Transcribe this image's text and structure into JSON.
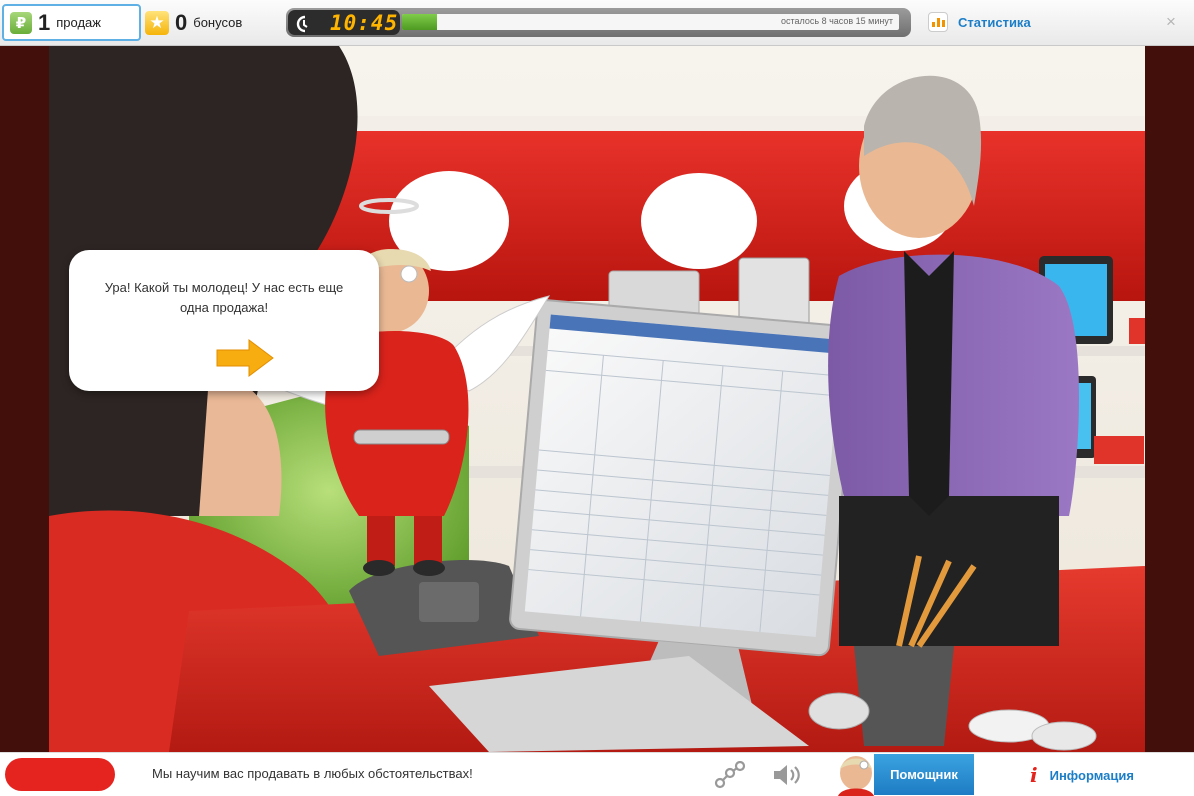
{
  "topbar": {
    "sales_icon": "ruble-icon",
    "sales_count": "1",
    "sales_label": "продаж",
    "bonus_icon": "star-icon",
    "bonus_count": "0",
    "bonus_label": "бонусов",
    "timer": {
      "clock_icon": "clock-icon",
      "time": "10:45",
      "remaining": "осталось 8 часов 15 минут",
      "progress": 0.07,
      "accent": "#ffb400",
      "fill_color": "#5aa82a"
    },
    "stats_icon": "bar-chart-icon",
    "stats_label": "Статистика",
    "close_label": "×"
  },
  "scene": {
    "speech_bubble": {
      "text": "Ура! Какой ты молодец! У нас есть еще одна продажа!",
      "next_icon": "arrow-right-icon"
    }
  },
  "bottombar": {
    "tagline": "Мы научим вас продавать в любых обстоятельствах!",
    "share_icon": "share-icon",
    "sound_icon": "speaker-icon",
    "assistant_label": "Помощник",
    "info_icon": "info-icon",
    "info_label": "Информация",
    "brand_color": "#e52420"
  }
}
